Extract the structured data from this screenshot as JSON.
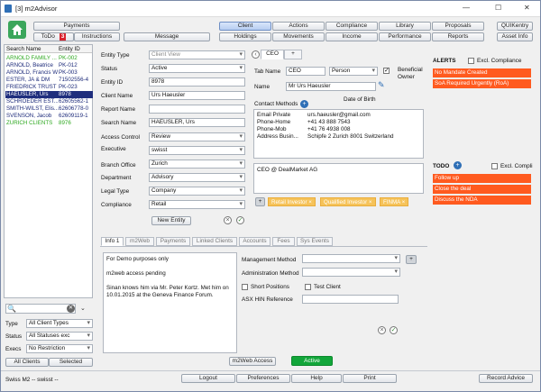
{
  "window": {
    "title": "[3] m2Advisor",
    "minimize": "—",
    "maximize": "☐",
    "close": "✕"
  },
  "topbar": {
    "payments": "Payments",
    "todo": "ToDo",
    "todo_badge": "3",
    "instructions": "Instructions",
    "message": "Message",
    "row1": [
      "Client",
      "Actions",
      "Compliance",
      "Library",
      "Proposals"
    ],
    "row2": [
      "Holdings",
      "Movements",
      "Income",
      "Performance",
      "Reports"
    ],
    "quikentry": "QUIKentry",
    "asset_info": "Asset Info"
  },
  "client_list": {
    "col_name": "Search Name",
    "col_id": "Entity ID",
    "rows": [
      {
        "name": "ARNOLD FAMILY ...",
        "id": "PK-002",
        "color": "#2ea820",
        "selected": false
      },
      {
        "name": "ARNOLD, Beatrice",
        "id": "PK-012",
        "color": "#1d2b7a",
        "selected": false
      },
      {
        "name": "ARNOLD, Francis W",
        "id": "PK-003",
        "color": "#1d2b7a",
        "selected": false
      },
      {
        "name": "ESTER, JA & DM",
        "id": "71502556-4",
        "color": "#1d2b7a",
        "selected": false
      },
      {
        "name": "FRIEDRICK TRUST",
        "id": "PK-023",
        "color": "#1d2b7a",
        "selected": false
      },
      {
        "name": "HAEUSLER, Urs",
        "id": "8978",
        "color": "#ffffff",
        "selected": true
      },
      {
        "name": "SCHROEDER EST...",
        "id": "62605562-1",
        "color": "#1d2b7a",
        "selected": false
      },
      {
        "name": "SMITH-WILST, Elis...",
        "id": "62606778-0",
        "color": "#1d2b7a",
        "selected": false
      },
      {
        "name": "SVENSON, Jacob",
        "id": "62609119-1",
        "color": "#1d2b7a",
        "selected": false
      },
      {
        "name": "ZURICH CLIENTS",
        "id": "8976",
        "color": "#2ea820",
        "selected": false
      }
    ]
  },
  "filters": {
    "type_label": "Type",
    "type_value": "All Client Types",
    "status_label": "Status",
    "status_value": "All Statuses exc",
    "execs_label": "Execs",
    "execs_value": "No Restriction",
    "all_clients": "All Clients",
    "selected": "Selected"
  },
  "entity_form": {
    "entity_type_label": "Entity Type",
    "entity_type": "Client View",
    "status_label": "Status",
    "status": "Active",
    "entity_id_label": "Entity ID",
    "entity_id": "8978",
    "client_name_label": "Client Name",
    "client_name": "Urs Haeusler",
    "report_name_label": "Report Name",
    "report_name": "",
    "search_name_label": "Search Name",
    "search_name": "HAEUSLER, Urs",
    "access_control_label": "Access Control",
    "access_control": "Review",
    "executive_label": "Executive",
    "executive": "swisst",
    "branch_office_label": "Branch Office",
    "branch_office": "Zurich",
    "department_label": "Department",
    "department": "Advisory",
    "legal_type_label": "Legal Type",
    "legal_type": "Company",
    "compliance_label": "Compliance",
    "compliance": "Retail",
    "new_entity": "New Entity"
  },
  "contact": {
    "tab_ceo": "CEO",
    "tab_add": "+",
    "tab_name_label": "Tab Name",
    "tab_name": "CEO",
    "person": "Person",
    "beneficial_owner": "Beneficial Owner",
    "name_label": "Name",
    "name": "Mr Urs Haeusler",
    "dob_label": "Date of Birth",
    "methods_label": "Contact Methods",
    "methods": [
      {
        "type": "Email Private",
        "value": "urs.haeusler@gmail.com"
      },
      {
        "type": "Phone-Home",
        "value": "+41 43 888 7543"
      },
      {
        "type": "Phone-Mob",
        "value": "+41 76 4938 008"
      },
      {
        "type": "Address Busin...",
        "value": "Schipfe 2    Zurich 8001 Switzerland"
      }
    ],
    "notes": "CEO @ DealMarket AG",
    "chips": [
      "Retail Investor",
      "Qualified Investor",
      "FINMA"
    ]
  },
  "alerts": {
    "title": "ALERTS",
    "excl": "Excl. Compliance",
    "items": [
      "No Mandate Created",
      "SoA Required Urgently (RoA)"
    ]
  },
  "todo": {
    "title": "TODO",
    "excl": "Excl. Compli",
    "items": [
      "Follow up",
      "Close the deal",
      "Discuss the NDA"
    ]
  },
  "bottom_tabs": [
    "Info 1",
    "m2Web",
    "Payments",
    "Linked Clients",
    "Accounts",
    "Fees",
    "Sys Events"
  ],
  "info": {
    "notes": [
      "For Demo purposes only",
      "",
      "m2web access pending",
      "",
      "Sinan knows him via Mr. Peter Kortz. Met him on",
      "10.01.2015 at the Geneva Finance Forum."
    ],
    "management_method_label": "Management Method",
    "administration_method_label": "Administration Method",
    "short_positions": "Short Positions",
    "test_client": "Test Client",
    "asx_hin_label": "ASX HIN Reference"
  },
  "m2web_access": "m2Web Access",
  "active": "Active",
  "footer": {
    "logout": "Logout",
    "preferences": "Preferences",
    "help": "Help",
    "print": "Print",
    "record_advice": "Record Advice"
  },
  "status_bar": "Swiss M2 -- swisst --"
}
